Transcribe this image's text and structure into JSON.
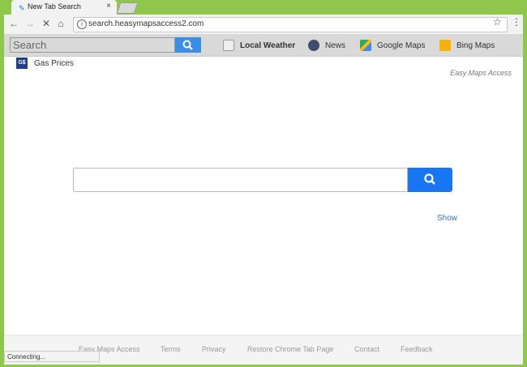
{
  "browser": {
    "tab_title": "New Tab Search",
    "close_glyph": "×",
    "url": "search.heasymapsaccess2.com",
    "back_glyph": "←",
    "forward_glyph": "→",
    "reload_glyph": "✕",
    "home_glyph": "⌂",
    "info_glyph": "i",
    "star_glyph": "☆",
    "menu_glyph": "⋮"
  },
  "topbar": {
    "search_placeholder": "Search",
    "links": [
      {
        "label": "Local Weather",
        "icon": "broken-image-icon",
        "bold": true
      },
      {
        "label": "News",
        "icon": "news-icon"
      },
      {
        "label": "Google Maps",
        "icon": "google-maps-icon"
      },
      {
        "label": "Bing Maps",
        "icon": "bing-maps-icon"
      }
    ]
  },
  "page": {
    "gas_label": "Gas Prices",
    "gas_icon_text": "G$",
    "brand": "Easy Maps Access",
    "show_label": "Show"
  },
  "footer": {
    "links": [
      "Easy Maps Access",
      "Terms",
      "Privacy",
      "Restore Chrome Tab Page",
      "Contact",
      "Feedback"
    ]
  },
  "status": {
    "text": "Connecting..."
  },
  "colors": {
    "frame": "#8fc64c",
    "search_button": "#1976f2",
    "top_search_button": "#3a8ee6",
    "link_blue": "#2f74c0"
  }
}
